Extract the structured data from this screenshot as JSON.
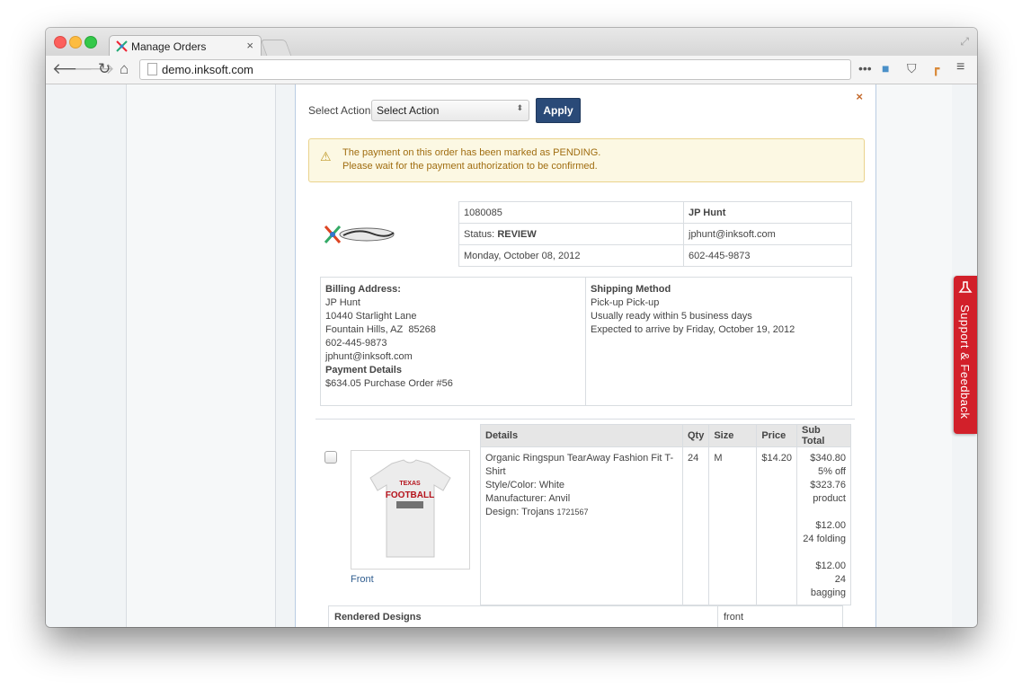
{
  "browser": {
    "tab_title": "Manage Orders",
    "tab_close": "×",
    "url": "demo.inksoft.com"
  },
  "toolbar_icons": [
    "back-arrow-icon",
    "forward-arrow-icon",
    "reload-icon",
    "home-icon",
    "more-icon",
    "extension-icon",
    "pocket-icon",
    "bookmark-icon",
    "menu-icon"
  ],
  "modal": {
    "close": "×",
    "select_label": "Select Action:",
    "select_value": "Select Action",
    "apply_label": "Apply",
    "alert": {
      "line1": "The payment on this order has been marked as PENDING.",
      "line2": "Please wait for the payment authorization to be confirmed."
    },
    "order": {
      "number": "1080085",
      "customer": "JP Hunt",
      "status_label": "Status:",
      "status_value": "REVIEW",
      "email": "jphunt@inksoft.com",
      "date": "Monday, October 08, 2012",
      "phone": "602-445-9873"
    },
    "billing": {
      "heading": "Billing Address:",
      "name": "JP Hunt",
      "street": "10440 Starlight Lane",
      "city": "Fountain Hills, AZ  85268",
      "phone": "602-445-9873",
      "email": "jphunt@inksoft.com",
      "payment_heading": "Payment Details",
      "payment": "$634.05 Purchase Order #56"
    },
    "shipping": {
      "heading": "Shipping Method",
      "method": "Pick-up Pick-up",
      "ready": "Usually ready within 5 business days",
      "expected": "Expected to arrive by Friday, October 19, 2012"
    },
    "items": {
      "headers": {
        "details": "Details",
        "qty": "Qty",
        "size": "Size",
        "price": "Price",
        "subtotal": "Sub Total"
      },
      "product_name": "Organic Ringspun TearAway Fashion Fit T-Shirt",
      "style": "Style/Color: White",
      "manufacturer": "Manufacturer: Anvil",
      "design": "Design: Trojans",
      "design_id": "1721567",
      "qty": "24",
      "size": "M",
      "price": "$14.20",
      "subtotal_lines": [
        "$340.80",
        "5% off",
        "$323.76",
        "product",
        "",
        "$12.00",
        "24 folding",
        "",
        "$12.00",
        "24 bagging"
      ],
      "front_link": "Front",
      "shirt_text_1": "TEXAS",
      "shirt_text_2": "FOOTBALL"
    },
    "rendered": {
      "heading": "Rendered Designs",
      "front": "front"
    }
  },
  "support_tab": "Support & Feedback",
  "logo_text": "InkSoft"
}
